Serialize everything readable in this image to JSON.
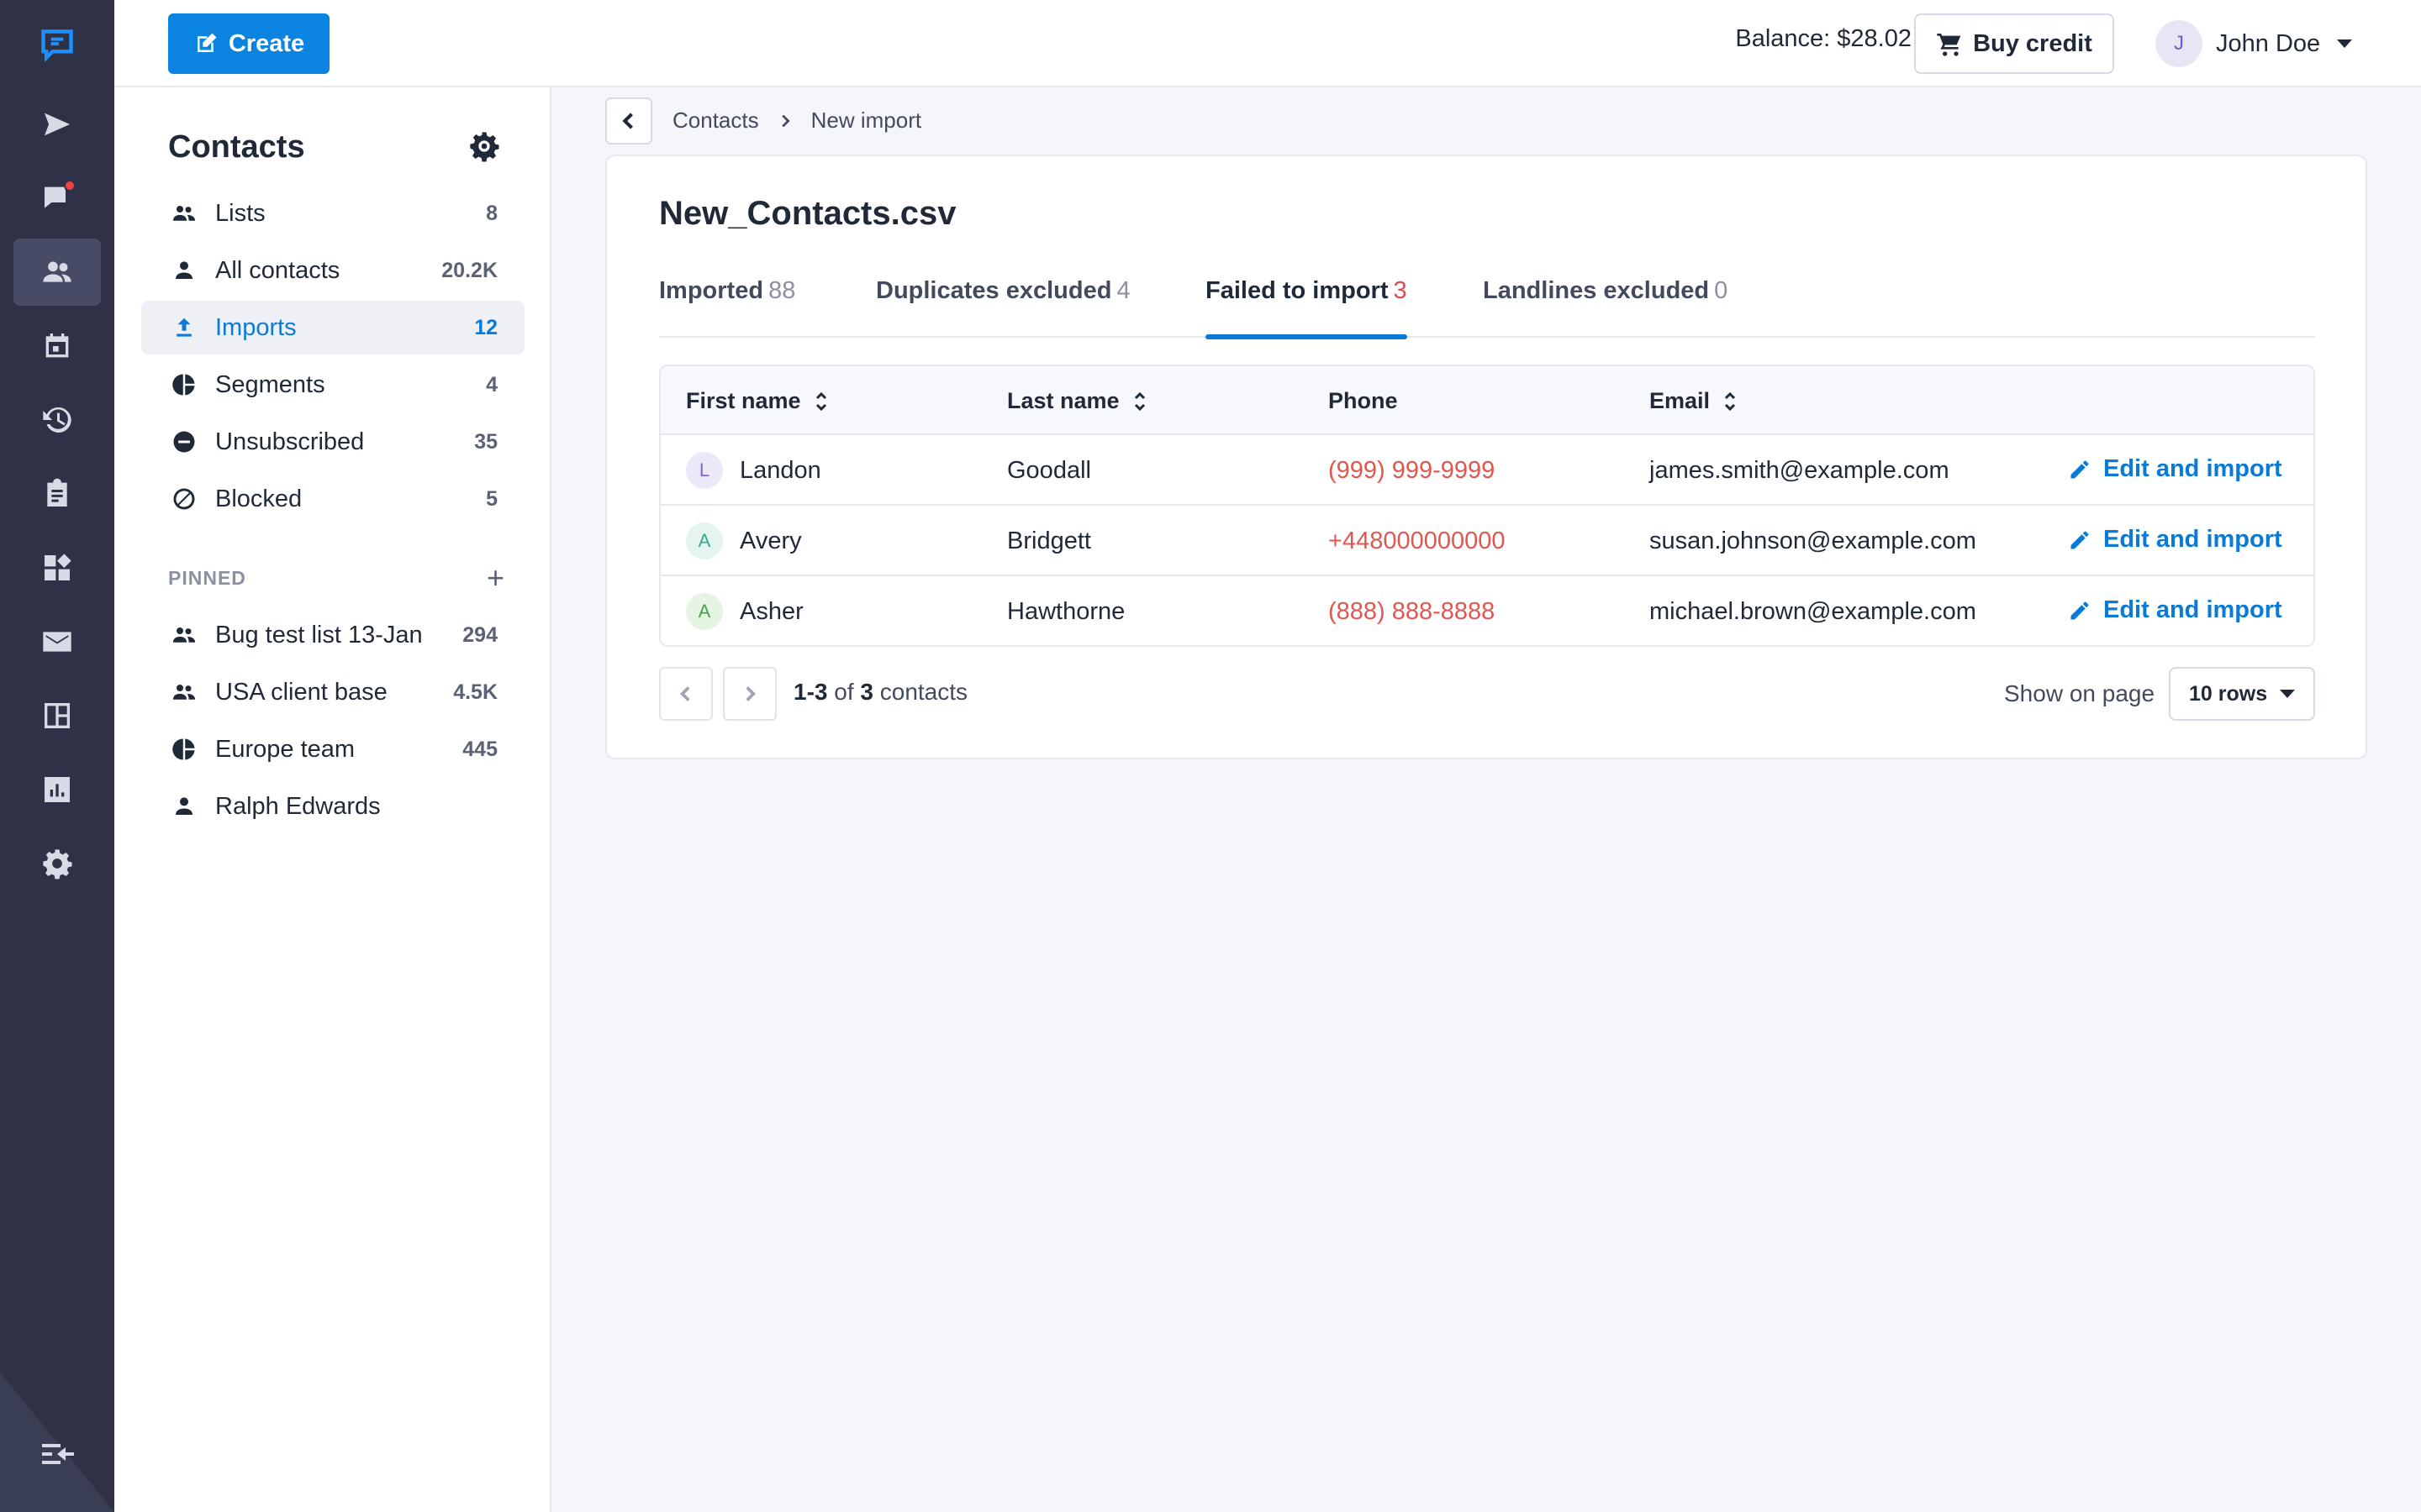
{
  "rail": {
    "items": [
      {
        "icon": "send-icon"
      },
      {
        "icon": "chat-icon"
      },
      {
        "icon": "contacts-icon"
      },
      {
        "icon": "calendar-icon"
      },
      {
        "icon": "history-icon"
      },
      {
        "icon": "clipboard-icon"
      },
      {
        "icon": "widgets-icon"
      },
      {
        "icon": "email-icon"
      },
      {
        "icon": "board-icon"
      },
      {
        "icon": "analytics-icon"
      },
      {
        "icon": "settings-icon"
      }
    ],
    "active_index": 2
  },
  "topbar": {
    "create_label": "Create",
    "balance": "Balance: $28.02",
    "buy_label": "Buy credit",
    "user_initial": "J",
    "user_name": "John Doe"
  },
  "sidebar": {
    "title": "Contacts",
    "items": [
      {
        "label": "Lists",
        "count": "8",
        "icon": "group-icon"
      },
      {
        "label": "All contacts",
        "count": "20.2K",
        "icon": "person-icon"
      },
      {
        "label": "Imports",
        "count": "12",
        "icon": "upload-icon"
      },
      {
        "label": "Segments",
        "count": "4",
        "icon": "pie-icon"
      },
      {
        "label": "Unsubscribed",
        "count": "35",
        "icon": "minus-circle-icon"
      },
      {
        "label": "Blocked",
        "count": "5",
        "icon": "block-icon"
      }
    ],
    "pinned_label": "PINNED",
    "pinned": [
      {
        "label": "Bug test list 13-Jan",
        "count": "294",
        "icon": "group-icon"
      },
      {
        "label": "USA client base",
        "count": "4.5K",
        "icon": "group-icon"
      },
      {
        "label": "Europe team",
        "count": "445",
        "icon": "pie-icon"
      },
      {
        "label": "Ralph Edwards",
        "count": "",
        "icon": "person-icon"
      }
    ]
  },
  "breadcrumb": {
    "parent": "Contacts",
    "current": "New import"
  },
  "card": {
    "title": "New_Contacts.csv",
    "tabs": [
      {
        "label": "Imported",
        "count": "88"
      },
      {
        "label": "Duplicates excluded",
        "count": "4"
      },
      {
        "label": "Failed to import",
        "count": "3"
      },
      {
        "label": "Landlines excluded",
        "count": "0"
      }
    ],
    "columns": [
      "First name",
      "Last name",
      "Phone",
      "Email"
    ],
    "rows": [
      {
        "initial": "L",
        "first": "Landon",
        "last": "Goodall",
        "phone": "(999) 999-9999",
        "email": "james.smith@example.com",
        "action": "Edit and import",
        "av_bg": "#ece8f8",
        "av_fg": "#7a6bd0"
      },
      {
        "initial": "A",
        "first": "Avery",
        "last": "Bridgett",
        "phone": "+448000000000",
        "email": "susan.johnson@example.com",
        "action": "Edit and import",
        "av_bg": "#e3f4f1",
        "av_fg": "#3aa891"
      },
      {
        "initial": "A",
        "first": "Asher",
        "last": "Hawthorne",
        "phone": "(888) 888-8888",
        "email": "michael.brown@example.com",
        "action": "Edit and import",
        "av_bg": "#e6f4e4",
        "av_fg": "#4aa04a"
      }
    ],
    "pager": {
      "range": "1-3",
      "of": "of",
      "total": "3",
      "unit": "contacts",
      "show_label": "Show on page",
      "rows_value": "10 rows"
    }
  }
}
